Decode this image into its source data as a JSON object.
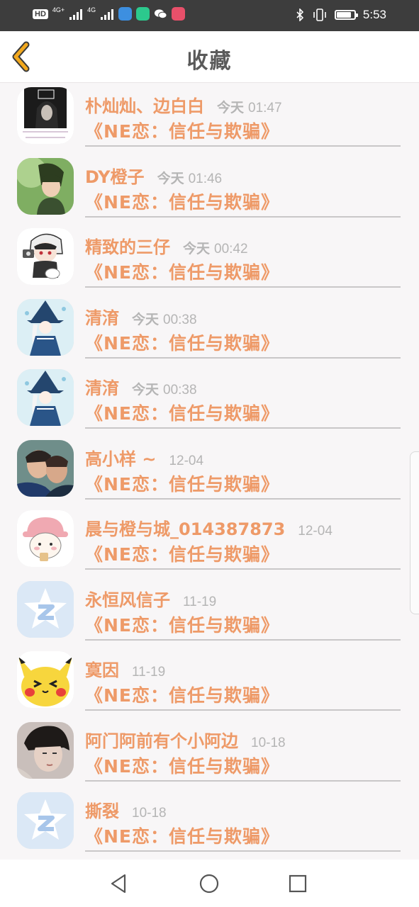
{
  "status_bar": {
    "hd_label": "HD",
    "network_1": "4G+",
    "network_2": "4G",
    "time": "5:53",
    "battery_level": 0.85
  },
  "header": {
    "title": "收藏",
    "back_icon": "chevron-left-icon"
  },
  "favorites": [
    {
      "name": "朴灿灿、边白白",
      "day": "今天",
      "time": "01:47",
      "subject": "《NE恋：信任与欺骗》",
      "avatar": "girl-portrait"
    },
    {
      "name": "DY橙子",
      "day": "今天",
      "time": "01:46",
      "subject": "《NE恋：信任与欺骗》",
      "avatar": "anime-boy-green"
    },
    {
      "name": "精致的三仔",
      "day": "今天",
      "time": "00:42",
      "subject": "《NE恋：信任与欺骗》",
      "avatar": "chibi-camera"
    },
    {
      "name": "清淯",
      "day": "今天",
      "time": "00:38",
      "subject": "《NE恋：信任与欺骗》",
      "avatar": "witch-blue"
    },
    {
      "name": "清淯",
      "day": "今天",
      "time": "00:38",
      "subject": "《NE恋：信任与欺骗》",
      "avatar": "witch-blue"
    },
    {
      "name": "高小样 ~",
      "day": "",
      "time": "12-04",
      "subject": "《NE恋：信任与欺骗》",
      "avatar": "couple-photo"
    },
    {
      "name": "晨与橙与城_014387873",
      "day": "",
      "time": "12-04",
      "subject": "《NE恋：信任与欺骗》",
      "avatar": "bear-hat"
    },
    {
      "name": "永恒风信子",
      "day": "",
      "time": "11-19",
      "subject": "《NE恋：信任与欺骗》",
      "avatar": "qzone-default"
    },
    {
      "name": "寞因",
      "day": "",
      "time": "11-19",
      "subject": "《NE恋：信任与欺骗》",
      "avatar": "pikachu"
    },
    {
      "name": "阿门阿前有个小阿边",
      "day": "",
      "time": "10-18",
      "subject": "《NE恋：信任与欺骗》",
      "avatar": "boy-portrait"
    },
    {
      "name": "撕裂",
      "day": "",
      "time": "10-18",
      "subject": "《NE恋：信任与欺骗》",
      "avatar": "qzone-default"
    }
  ],
  "nav_bar": {
    "back": "triangle-back-icon",
    "home": "circle-home-icon",
    "recents": "square-recents-icon"
  },
  "colors": {
    "accent": "#ee9a68",
    "title": "#5a5a5a",
    "timestamp": "#b5b5b5",
    "back_icon": "#f2a81d"
  }
}
